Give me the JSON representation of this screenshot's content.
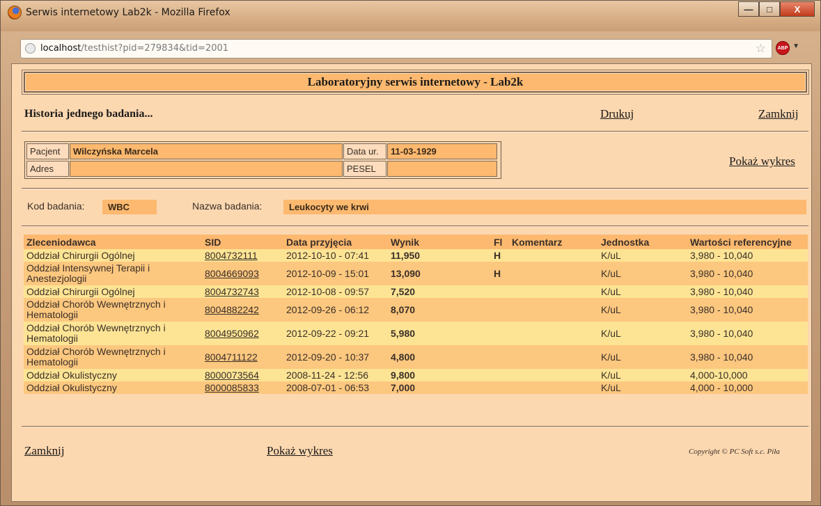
{
  "browser": {
    "window_title": "Serwis internetowy Lab2k - Mozilla Firefox",
    "url_host": "localhost",
    "url_path": "/testhist?pid=279834&tid=2001",
    "minimize": "—",
    "maximize": "□",
    "close": "X",
    "abp_label": "ABP"
  },
  "page": {
    "header": "Laboratoryjny serwis internetowy - Lab2k",
    "subtitle": "Historia jednego badania...",
    "print_link": "Drukuj",
    "close_link": "Zamknij",
    "chart_link": "Pokaż wykres",
    "patient": {
      "name_label": "Pacjent",
      "name": "Wilczyńska Marcela",
      "dob_label": "Data ur.",
      "dob": "11-03-1929",
      "address_label": "Adres",
      "address": "",
      "pesel_label": "PESEL",
      "pesel": ""
    },
    "test": {
      "code_label": "Kod badania:",
      "code": "WBC",
      "name_label": "Nazwa badania:",
      "name": "Leukocyty we krwi"
    },
    "table": {
      "headers": [
        "Zleceniodawca",
        "SID",
        "Data przyjęcia",
        "Wynik",
        "Fl",
        "Komentarz",
        "Jednostka",
        "Wartości referencyjne"
      ],
      "rows": [
        {
          "ordering": "Oddział Chirurgii Ogólnej",
          "sid": "8004732111",
          "date": "2012-10-10 - 07:41",
          "result": "11,950",
          "flag": "H",
          "comment": "",
          "unit": "K/uL",
          "ref": "3,980 - 10,040"
        },
        {
          "ordering": "Oddział Intensywnej Terapii i Anestezjologii",
          "sid": "8004669093",
          "date": "2012-10-09 - 15:01",
          "result": "13,090",
          "flag": "H",
          "comment": "",
          "unit": "K/uL",
          "ref": "3,980 - 10,040"
        },
        {
          "ordering": "Oddział Chirurgii Ogólnej",
          "sid": "8004732743",
          "date": "2012-10-08 - 09:57",
          "result": "7,520",
          "flag": "",
          "comment": "",
          "unit": "K/uL",
          "ref": "3,980 - 10,040"
        },
        {
          "ordering": "Oddział Chorób Wewnętrznych i Hematologii",
          "sid": "8004882242",
          "date": "2012-09-26 - 06:12",
          "result": "8,070",
          "flag": "",
          "comment": "",
          "unit": "K/uL",
          "ref": "3,980 - 10,040"
        },
        {
          "ordering": "Oddział Chorób Wewnętrznych i Hematologii",
          "sid": "8004950962",
          "date": "2012-09-22 - 09:21",
          "result": "5,980",
          "flag": "",
          "comment": "",
          "unit": "K/uL",
          "ref": "3,980 - 10,040"
        },
        {
          "ordering": "Oddział Chorób Wewnętrznych i Hematologii",
          "sid": "8004711122",
          "date": "2012-09-20 - 10:37",
          "result": "4,800",
          "flag": "",
          "comment": "",
          "unit": "K/uL",
          "ref": "3,980 - 10,040"
        },
        {
          "ordering": "Oddział Okulistyczny",
          "sid": "8000073564",
          "date": "2008-11-24 - 12:56",
          "result": "9,800",
          "flag": "",
          "comment": "",
          "unit": "K/uL",
          "ref": "4,000-10,000"
        },
        {
          "ordering": "Oddział Okulistyczny",
          "sid": "8000085833",
          "date": "2008-07-01 - 06:53",
          "result": "7,000",
          "flag": "",
          "comment": "",
          "unit": "K/uL",
          "ref": "4,000 - 10,000"
        }
      ]
    },
    "footer": {
      "close_link": "Zamknij",
      "chart_link": "Pokaż wykres",
      "copyright": "Copyright ©  PC Soft s.c. Piła"
    },
    "colors": {
      "page_bg": "#fcd8b1",
      "accent": "#fcb96f",
      "row_light": "#fde495",
      "row_dark": "#fcc77f"
    }
  }
}
